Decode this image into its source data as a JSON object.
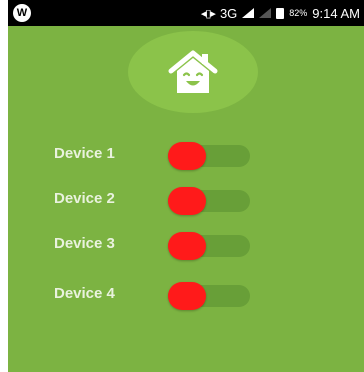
{
  "status_bar": {
    "app_badge": "W",
    "network": "3G",
    "battery_percent": "82%",
    "time": "9:14 AM"
  },
  "devices": [
    {
      "label": "Device 1",
      "on": false
    },
    {
      "label": "Device 2",
      "on": false
    },
    {
      "label": "Device 3",
      "on": false
    },
    {
      "label": "Device 4",
      "on": false
    }
  ],
  "colors": {
    "background": "#7cb342",
    "logo_circle": "#8bc34a",
    "switch_track": "#689f38",
    "switch_knob_off": "#ff1a1a",
    "label_text": "#e9f2de"
  }
}
